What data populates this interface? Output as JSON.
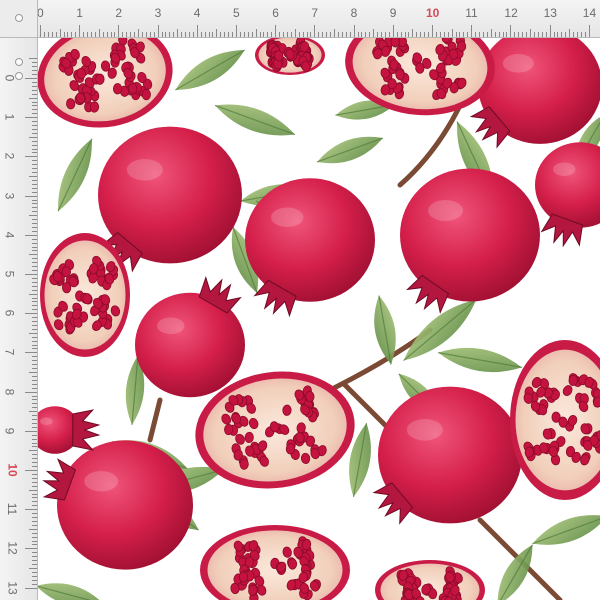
{
  "ruler_top": {
    "numbers": [
      "0",
      "1",
      "2",
      "3",
      "4",
      "5",
      "6",
      "7",
      "8",
      "9",
      "10",
      "11",
      "12",
      "13",
      "14"
    ],
    "accent_number": "10"
  },
  "ruler_left": {
    "numbers": [
      "0",
      "1",
      "2",
      "3",
      "4",
      "5",
      "6",
      "7",
      "8",
      "9",
      "10",
      "11",
      "12",
      "13"
    ],
    "accent_number": "10"
  },
  "colors": {
    "background": "#ffffff",
    "pomegranate_skin": "#d41f4a",
    "pomegranate_dark": "#a0102f",
    "pith": "#f3d2bf",
    "seed": "#c4133f",
    "leaf": "#7fa55a",
    "leaf_dark": "#4f7a3a",
    "branch": "#7a4a34",
    "ruler_accent": "#d64a58"
  },
  "pattern": {
    "description_icon": "pomegranate-pattern-icon"
  }
}
